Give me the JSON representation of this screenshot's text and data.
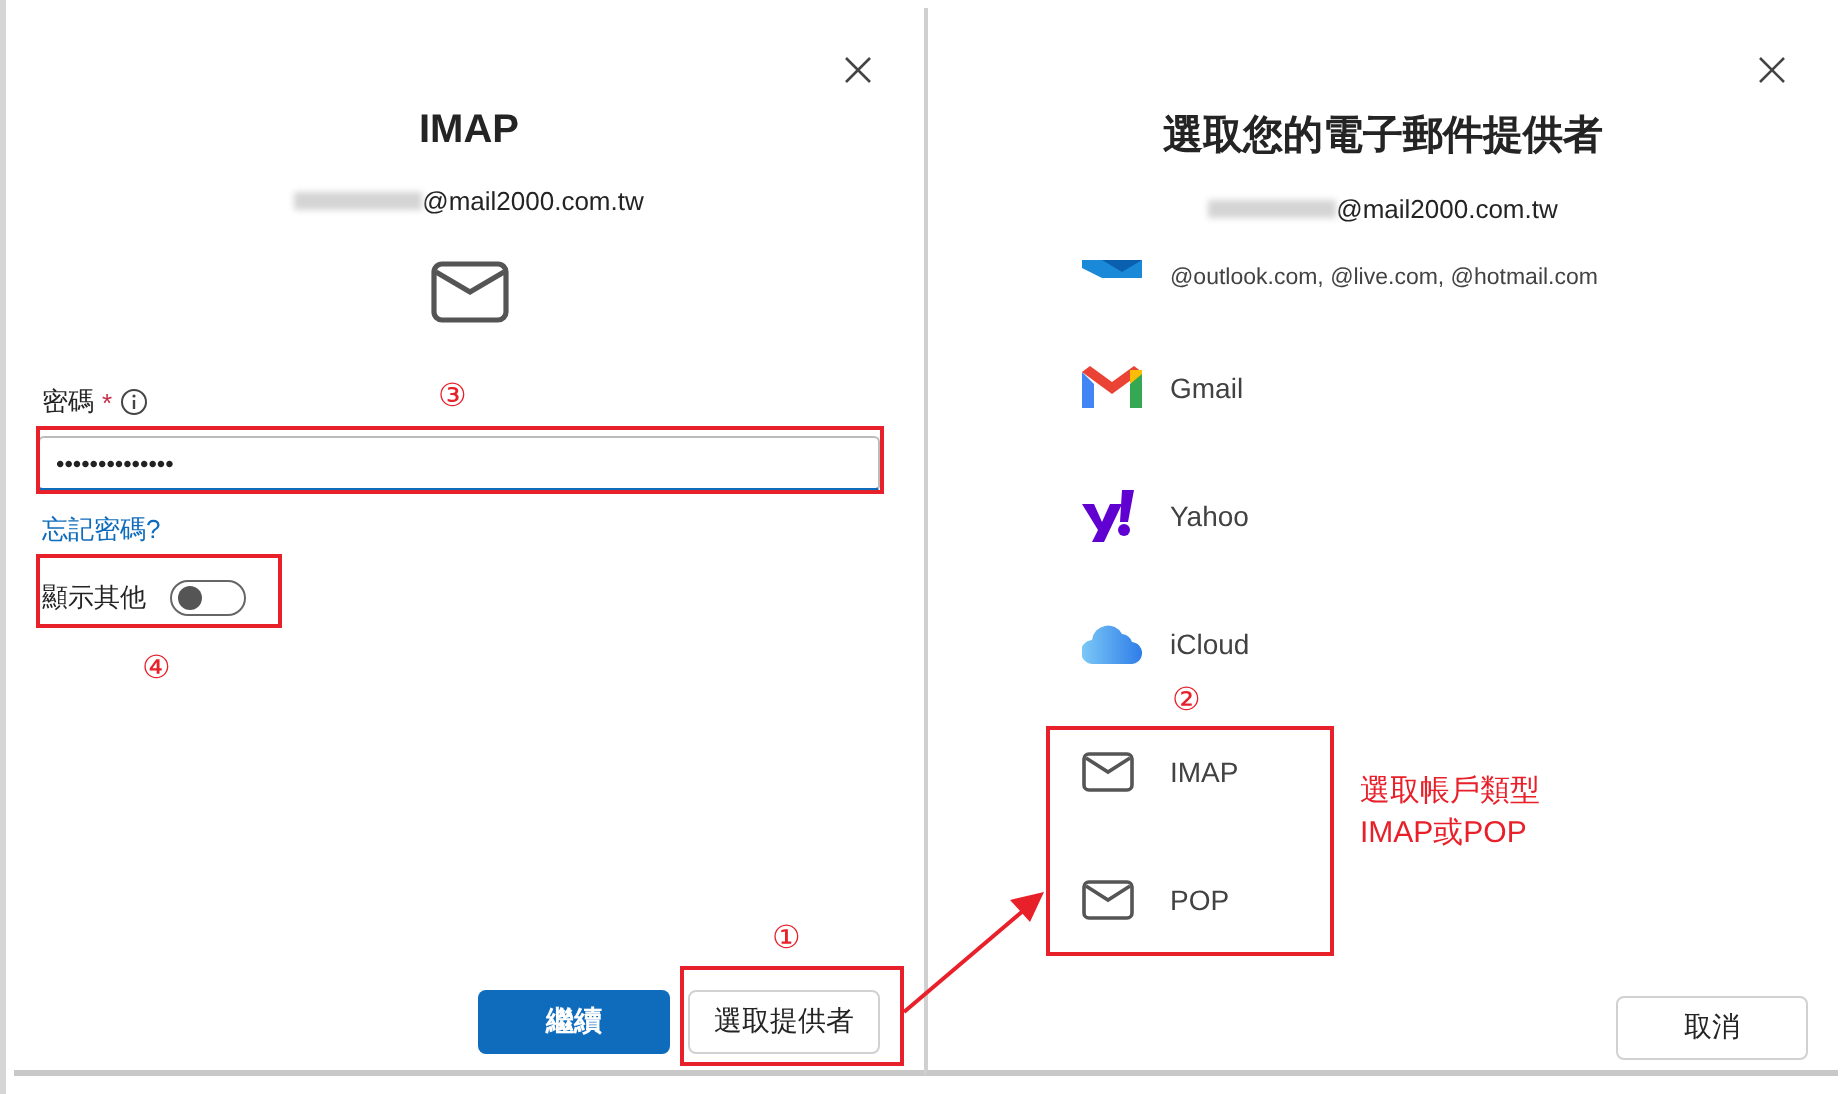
{
  "left_dialog": {
    "title": "IMAP",
    "email_domain": "@mail2000.com.tw",
    "password_field": {
      "label": "密碼",
      "required_mark": "*",
      "value": "••••••••••••••"
    },
    "forgot_link": "忘記密碼?",
    "toggle": {
      "label": "顯示其他",
      "on": false
    },
    "buttons": [
      {
        "label": "繼續",
        "kind": "primary"
      },
      {
        "label": "選取提供者",
        "kind": "secondary"
      }
    ]
  },
  "right_dialog": {
    "title": "選取您的電子郵件提供者",
    "email_domain": "@mail2000.com.tw",
    "providers": [
      {
        "kind": "outlook",
        "label": "@outlook.com, @live.com, @hotmail.com"
      },
      {
        "kind": "gmail",
        "label": "Gmail"
      },
      {
        "kind": "yahoo",
        "label": "Yahoo"
      },
      {
        "kind": "icloud",
        "label": "iCloud"
      },
      {
        "kind": "mail",
        "label": "IMAP"
      },
      {
        "kind": "mail",
        "label": "POP"
      }
    ],
    "cancel_button": "取消"
  },
  "annotations": {
    "steps": [
      "①",
      "②",
      "③",
      "④"
    ],
    "note_lines": [
      "選取帳戶類型",
      "IMAP或POP"
    ]
  }
}
